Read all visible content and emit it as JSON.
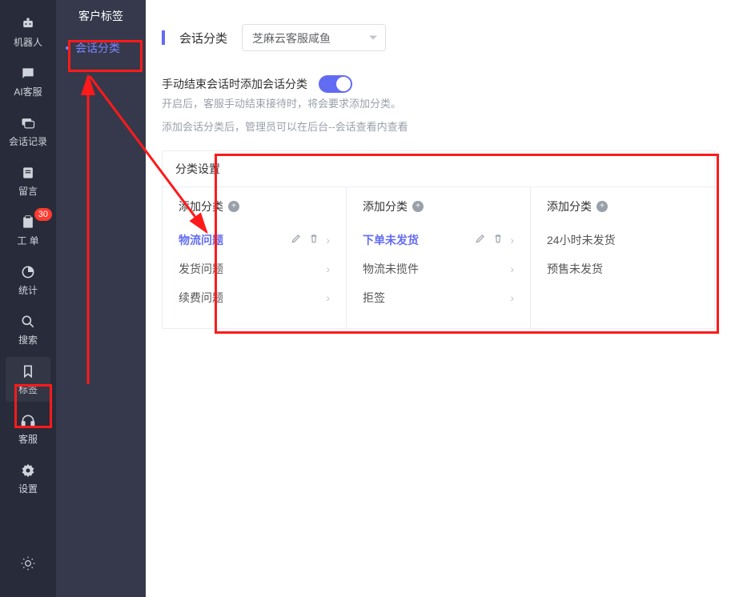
{
  "nav": [
    {
      "label": "机器人"
    },
    {
      "label": "AI客服"
    },
    {
      "label": "会话记录"
    },
    {
      "label": "留言"
    },
    {
      "label": "工 单",
      "badge": "30"
    },
    {
      "label": "统计"
    },
    {
      "label": "搜索"
    },
    {
      "label": "标签"
    },
    {
      "label": "客服"
    },
    {
      "label": "设置"
    }
  ],
  "sub": {
    "title": "客户标签",
    "items": [
      "会话分类"
    ]
  },
  "main": {
    "header_label": "会话分类",
    "select_value": "芝麻云客服咸鱼",
    "toggle_label": "手动结束会话时添加会话分类",
    "toggle_on": true,
    "hint1": "开启后，客服手动结束接待时，将会要求添加分类。",
    "hint2": "添加会话分类后，管理员可以在后台--会话查看内查看",
    "panel_title": "分类设置",
    "cols": [
      {
        "add_label": "添加分类",
        "items": [
          {
            "name": "物流问题",
            "selected": true
          },
          {
            "name": "发货问题"
          },
          {
            "name": "续费问题"
          }
        ]
      },
      {
        "add_label": "添加分类",
        "items": [
          {
            "name": "下单未发货",
            "selected": true
          },
          {
            "name": "物流未揽件"
          },
          {
            "name": "拒签"
          }
        ]
      },
      {
        "add_label": "添加分类",
        "items": [
          {
            "name": "24小时未发货"
          },
          {
            "name": "预售未发货"
          }
        ]
      }
    ]
  },
  "colors": {
    "accent": "#626CF2",
    "nav_bg": "#272B3A",
    "sub_bg": "#35394B",
    "highlight": "#ff1a1a"
  }
}
